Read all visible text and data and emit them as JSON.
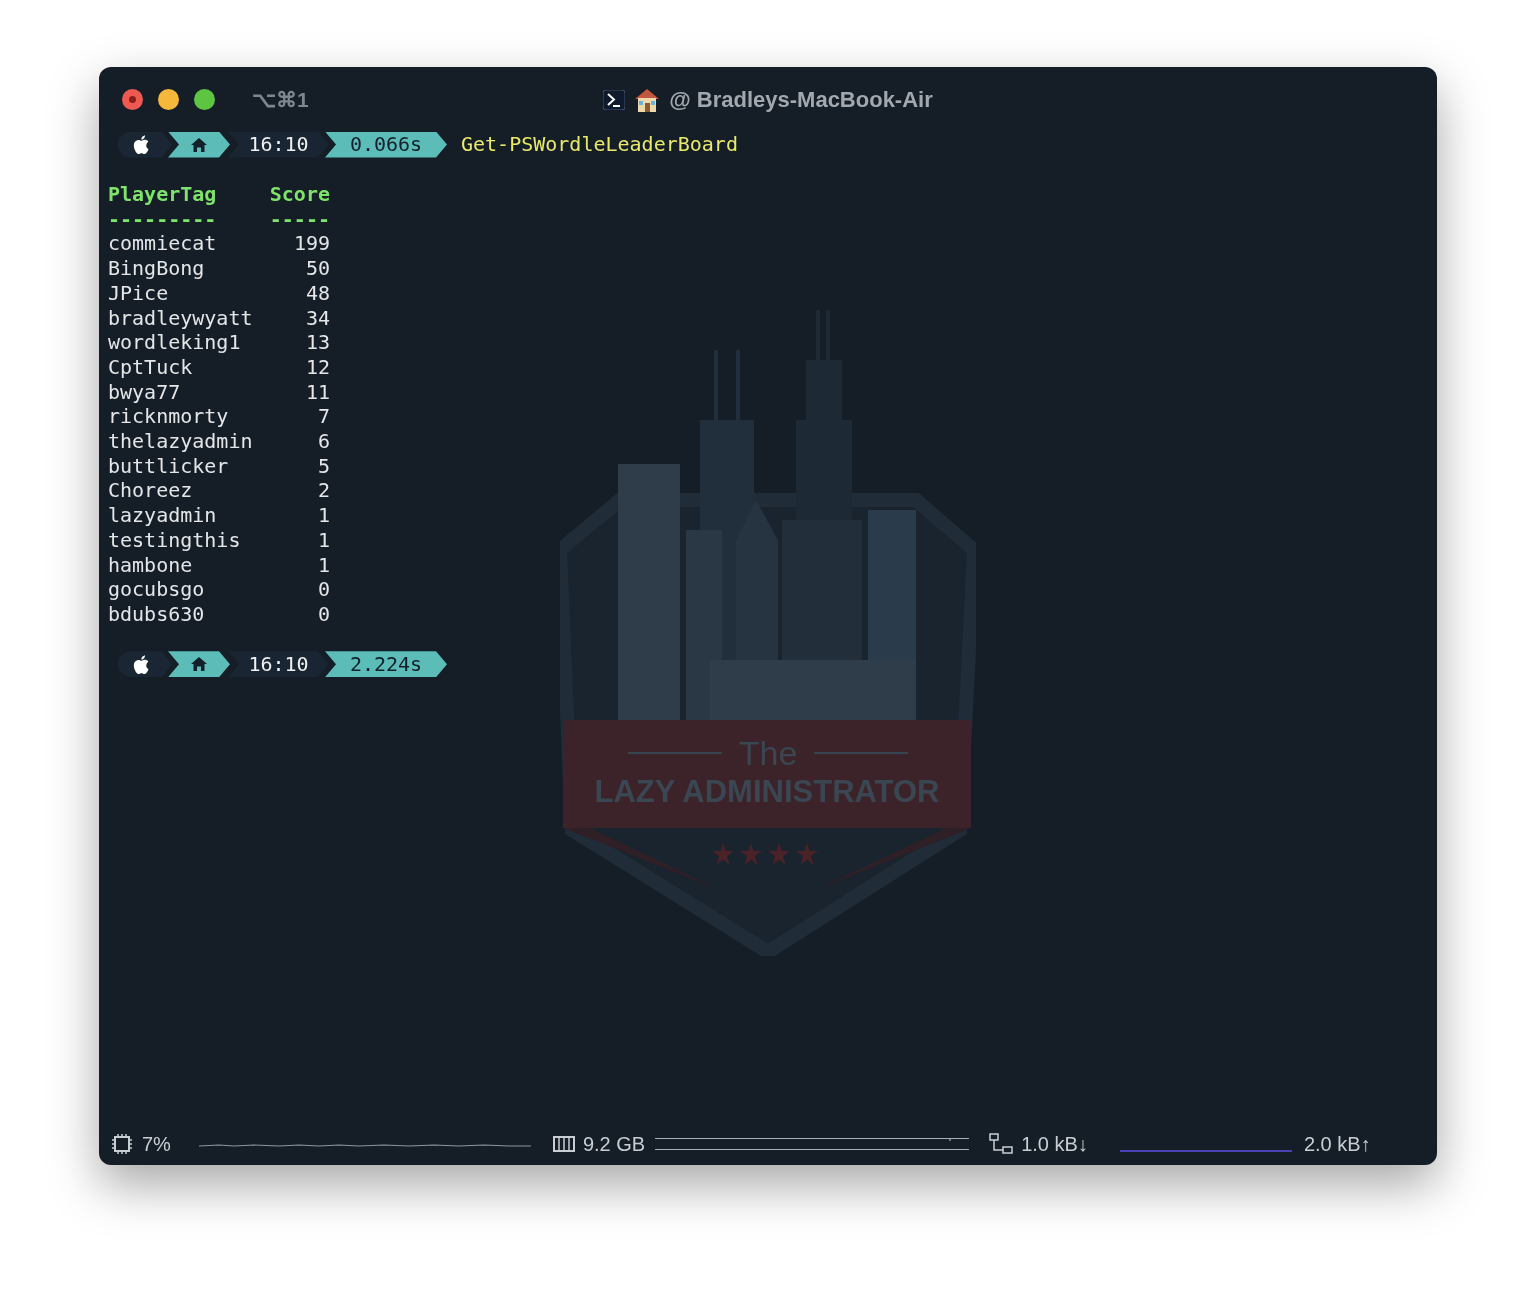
{
  "window": {
    "shortcut": "⌥⌘1",
    "title": "@ Bradleys-MacBook-Air"
  },
  "prompts": [
    {
      "time": "16:10",
      "duration": "0.066s",
      "command": "Get-PSWordleLeaderBoard"
    },
    {
      "time": "16:10",
      "duration": "2.224s"
    }
  ],
  "table": {
    "columns": [
      "PlayerTag",
      "Score"
    ],
    "separators": [
      "---------",
      "-----"
    ],
    "rows": [
      [
        "commiecat",
        "199"
      ],
      [
        "BingBong",
        "50"
      ],
      [
        "JPice",
        "48"
      ],
      [
        "bradleywyatt",
        "34"
      ],
      [
        "wordleking1",
        "13"
      ],
      [
        "CptTuck",
        "12"
      ],
      [
        "bwya77",
        "11"
      ],
      [
        "ricknmorty",
        "7"
      ],
      [
        "thelazyadmin",
        "6"
      ],
      [
        "buttlicker",
        "5"
      ],
      [
        "Choreez",
        "2"
      ],
      [
        "lazyadmin",
        "1"
      ],
      [
        "testingthis",
        "1"
      ],
      [
        "hambone",
        "1"
      ],
      [
        "gocubsgo",
        "0"
      ],
      [
        "bdubs630",
        "0"
      ]
    ]
  },
  "background_logo": {
    "top": "The",
    "name": "LAZY ADMINISTRATOR"
  },
  "status_bar": {
    "cpu": "7%",
    "memory": "9.2 GB",
    "download": "1.0 kB↓",
    "upload": "2.0 kB↑"
  }
}
